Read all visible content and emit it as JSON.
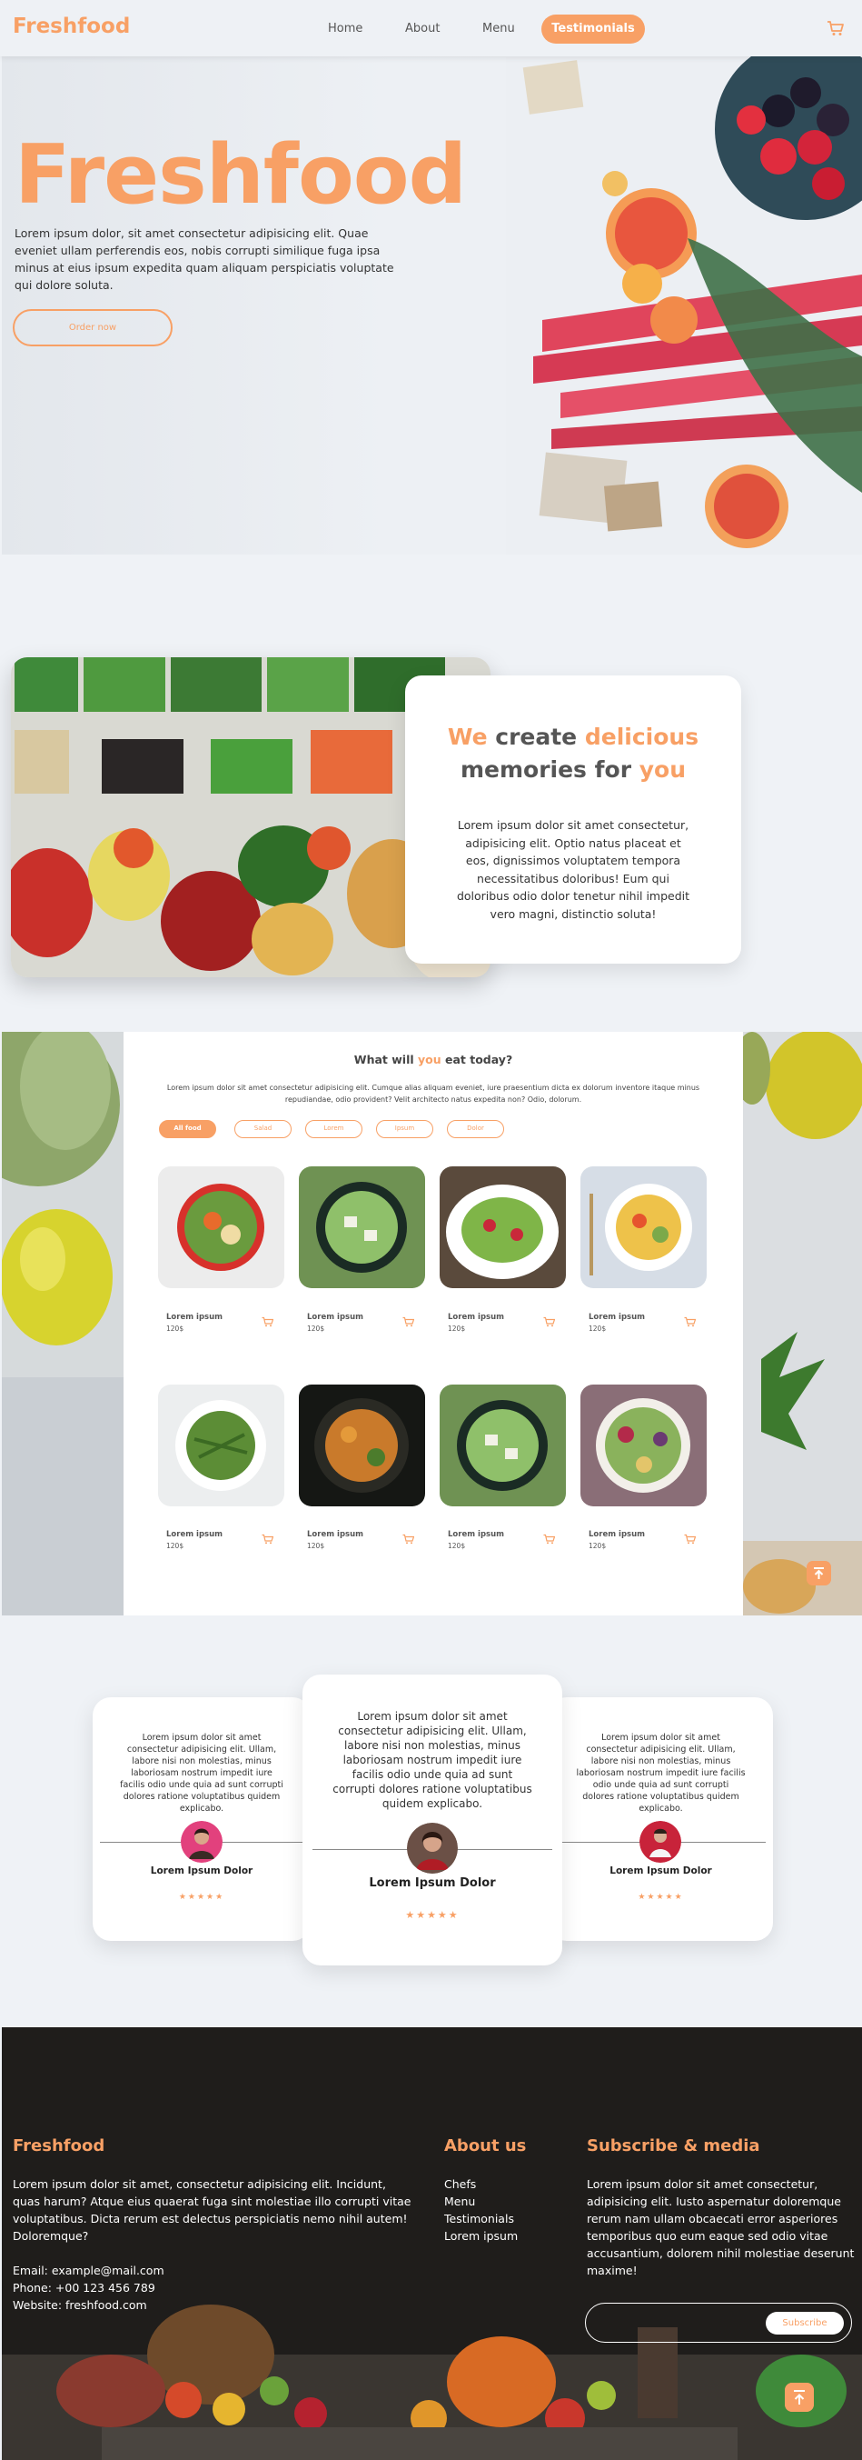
{
  "nav": {
    "logo": "Freshfood",
    "links": [
      "Home",
      "About",
      "Menu"
    ],
    "active_button": "Testimonials",
    "cart_icon": "shopping-cart-icon"
  },
  "hero": {
    "title": "Freshfood",
    "text": "Lorem ipsum dolor, sit amet consectetur adipisicing elit. Quae eveniet ullam perferendis eos, nobis corrupti similique fuga ipsa minus at eius ipsum expedita quam aliquam perspiciatis voluptate qui dolore soluta.",
    "button": "Order now"
  },
  "about": {
    "heading_parts": [
      "We",
      " create ",
      "delicious",
      "memories for ",
      "you"
    ],
    "text": "Lorem ipsum dolor sit amet consectetur, adipisicing elit. Optio natus placeat et eos, dignissimos voluptatem tempora necessitatibus doloribus! Eum qui doloribus odio dolor tenetur nihil impedit vero magni, distinctio soluta!"
  },
  "menu": {
    "title_parts": [
      "What will ",
      "you",
      " eat today?"
    ],
    "description": "Lorem ipsum dolor sit amet consectetur adipisicing elit. Cumque alias aliquam eveniet, iure praesentium dicta ex dolorum inventore itaque minus repudiandae, odio provident? Velit architecto natus expedita non? Odio, dolorum.",
    "filters": [
      "All food",
      "Salad",
      "Lorem",
      "Ipsum",
      "Dolor"
    ],
    "items": [
      {
        "name": "Lorem ipsum",
        "price": "120$"
      },
      {
        "name": "Lorem ipsum",
        "price": "120$"
      },
      {
        "name": "Lorem ipsum",
        "price": "120$"
      },
      {
        "name": "Lorem ipsum",
        "price": "120$"
      },
      {
        "name": "Lorem ipsum",
        "price": "120$"
      },
      {
        "name": "Lorem ipsum",
        "price": "120$"
      },
      {
        "name": "Lorem ipsum",
        "price": "120$"
      },
      {
        "name": "Lorem ipsum",
        "price": "120$"
      }
    ]
  },
  "testimonials": [
    {
      "text": "Lorem ipsum dolor sit amet consectetur adipisicing elit. Ullam, labore nisi non molestias, minus laboriosam nostrum impedit iure facilis odio unde quia ad sunt corrupti dolores ratione voluptatibus quidem explicabo.",
      "name": "Lorem Ipsum Dolor",
      "stars": "★★★★★"
    },
    {
      "text": "Lorem ipsum dolor sit amet consectetur adipisicing elit. Ullam, labore nisi non molestias, minus laboriosam nostrum impedit iure facilis odio unde quia ad sunt corrupti dolores ratione voluptatibus quidem explicabo.",
      "name": "Lorem Ipsum Dolor",
      "stars": "★★★★★"
    },
    {
      "text": "Lorem ipsum dolor sit amet consectetur adipisicing elit. Ullam, labore nisi non molestias, minus laboriosam nostrum impedit iure facilis odio unde quia ad sunt corrupti dolores ratione voluptatibus quidem explicabo.",
      "name": "Lorem Ipsum Dolor",
      "stars": "★★★★★"
    }
  ],
  "footer": {
    "brand": {
      "title": "Freshfood",
      "text": "Lorem ipsum dolor sit amet, consectetur adipisicing elit. Incidunt, quas harum? Atque eius quaerat fuga sint molestiae illo corrupti vitae voluptatibus. Dicta rerum est delectus perspiciatis nemo nihil autem! Doloremque?",
      "email": "Email: example@mail.com",
      "phone": "Phone: +00 123 456 789",
      "website": "Website: freshfood.com"
    },
    "about": {
      "title": "About us",
      "links": [
        "Chefs",
        "Menu",
        "Testimonials",
        "Lorem ipsum"
      ]
    },
    "subscribe": {
      "title": "Subscribe & media",
      "text": "Lorem ipsum dolor sit amet consectetur, adipisicing elit. Iusto aspernatur doloremque rerum nam ullam obcaecati error asperiores temporibus quo eum eaque sed odio vitae accusantium, dolorem nihil molestiae deserunt maxime!",
      "input_placeholder": "",
      "button": "Subscribe"
    }
  },
  "colors": {
    "accent": "#f8a065",
    "background": "#eff2f6",
    "footer": "#1d1c1b"
  }
}
